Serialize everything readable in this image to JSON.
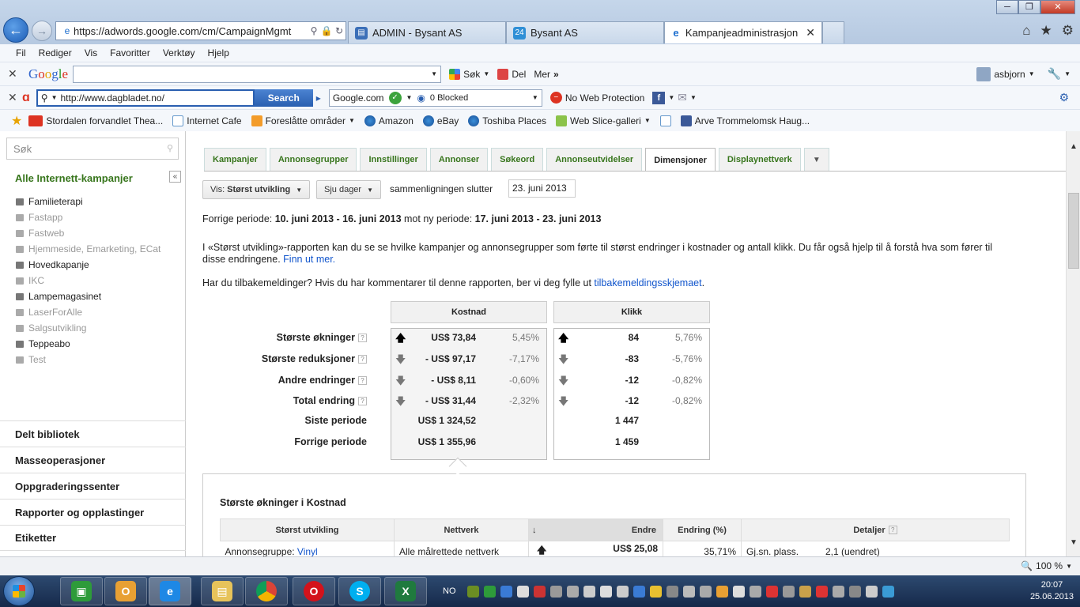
{
  "browser": {
    "url": "https://adwords.google.com/cm/CampaignMgmt",
    "tabs": [
      {
        "title": "ADMIN - Bysant AS",
        "active": false
      },
      {
        "title": "Bysant AS",
        "active": false
      },
      {
        "title": "Kampanjeadministrasjon",
        "active": true
      }
    ],
    "menu": [
      "Fil",
      "Rediger",
      "Vis",
      "Favoritter",
      "Verktøy",
      "Hjelp"
    ],
    "google_toolbar": {
      "logo": "Google",
      "search_value": "",
      "sok_label": "Søk",
      "del_label": "Del",
      "mer_label": "Mer",
      "user": "asbjorn"
    },
    "avira_toolbar": {
      "search_value": "http://www.dagbladet.no/",
      "search_button": "Search",
      "engine": "Google.com",
      "blocked": "0 Blocked",
      "web_protection": "No Web Protection"
    },
    "favorites": [
      "Stordalen forvandlet Thea...",
      "Internet Cafe",
      "Foreslåtte områder",
      "Amazon",
      "eBay",
      "Toshiba Places",
      "Web Slice-galleri",
      "Arve Trommelomsk Haug..."
    ],
    "status": {
      "zoom": "100 %"
    }
  },
  "sidebar": {
    "search_placeholder": "Søk",
    "title": "Alle Internett-kampanjer",
    "collapse_label": "«",
    "campaigns": [
      {
        "name": "Familieterapi",
        "paused": false
      },
      {
        "name": "Fastapp",
        "paused": true
      },
      {
        "name": "Fastweb",
        "paused": true
      },
      {
        "name": "Hjemmeside, Emarketing, ECat",
        "paused": true
      },
      {
        "name": "Hovedkapanje",
        "paused": false
      },
      {
        "name": "IKC",
        "paused": true
      },
      {
        "name": "Lampemagasinet",
        "paused": false
      },
      {
        "name": "LaserForAlle",
        "paused": true
      },
      {
        "name": "Salgsutvikling",
        "paused": true
      },
      {
        "name": "Teppeabo",
        "paused": false
      },
      {
        "name": "Test",
        "paused": true
      }
    ],
    "nav": [
      "Delt bibliotek",
      "Masseoperasjoner",
      "Oppgraderingssenter",
      "Rapporter og opplastinger",
      "Etiketter"
    ]
  },
  "content": {
    "tabs": [
      {
        "label": "Kampanjer",
        "active": false
      },
      {
        "label": "Annonsegrupper",
        "active": false
      },
      {
        "label": "Innstillinger",
        "active": false
      },
      {
        "label": "Annonser",
        "active": false
      },
      {
        "label": "Søkeord",
        "active": false
      },
      {
        "label": "Annonseutvidelser",
        "active": false
      },
      {
        "label": "Dimensjoner",
        "active": true
      },
      {
        "label": "Displaynettverk",
        "active": false
      }
    ],
    "more_tabs": "▼",
    "view_prefix": "Vis:",
    "view_value": "Størst utvikling",
    "period_button": "Sju dager",
    "compare_label": "sammenligningen slutter",
    "compare_date": "23. juni 2013",
    "period": {
      "prefix": "Forrige periode: ",
      "prev": "10. juni 2013 - 16. juni 2013",
      "middle": " mot ny periode: ",
      "next": "17. juni 2013 - 23. juni 2013"
    },
    "description": "I «Størst utvikling»-rapporten kan du se se hvilke kampanjer og annonsegrupper som førte til størst endringer i kostnader og antall klikk. Du får også hjelp til å forstå hva som fører til disse endringene. ",
    "description_link": "Finn ut mer.",
    "feedback_text": "Har du tilbakemeldinger? Hvis du har kommentarer til denne rapporten, ber vi deg fylle ut ",
    "feedback_link": "tilbakemeldingsskjemaet",
    "feedback_end": ".",
    "summary": {
      "cost_header": "Kostnad",
      "clicks_header": "Klikk",
      "rows": [
        {
          "label": "Største økninger",
          "help": true,
          "dir": "up",
          "cost": "US$ 73,84",
          "cost_pct": "5,45%",
          "clicks": "84",
          "clicks_pct": "5,76%"
        },
        {
          "label": "Største reduksjoner",
          "help": true,
          "dir": "down",
          "cost": "- US$ 97,17",
          "cost_pct": "-7,17%",
          "clicks": "-83",
          "clicks_pct": "-5,76%"
        },
        {
          "label": "Andre endringer",
          "help": true,
          "dir": "down",
          "cost": "- US$ 8,11",
          "cost_pct": "-0,60%",
          "clicks": "-12",
          "clicks_pct": "-0,82%"
        },
        {
          "label": "Total endring",
          "help": true,
          "dir": "down",
          "cost": "- US$ 31,44",
          "cost_pct": "-2,32%",
          "clicks": "-12",
          "clicks_pct": "-0,82%"
        },
        {
          "label": "Siste periode",
          "help": false,
          "dir": "",
          "cost": "US$ 1 324,52",
          "cost_pct": "",
          "clicks": "1 447",
          "clicks_pct": ""
        },
        {
          "label": "Forrige periode",
          "help": false,
          "dir": "",
          "cost": "US$ 1 355,96",
          "cost_pct": "",
          "clicks": "1 459",
          "clicks_pct": ""
        }
      ]
    },
    "detail": {
      "title": "Største økninger i Kostnad",
      "columns": [
        "Størst utvikling",
        "Nettverk",
        "Endre",
        "Endring (%)",
        "Detaljer"
      ],
      "row": {
        "prefix": "Annonsegruppe: ",
        "name": "Vinyl",
        "network": "Alle målrettede nettverk",
        "change": "US$ 25,08",
        "change_pct": "35,71%",
        "detail_label": "Gj.sn. plass.",
        "detail_value": "2,1 (uendret)"
      }
    }
  },
  "taskbar": {
    "lang": "NO",
    "time": "20:07",
    "date": "25.06.2013"
  }
}
